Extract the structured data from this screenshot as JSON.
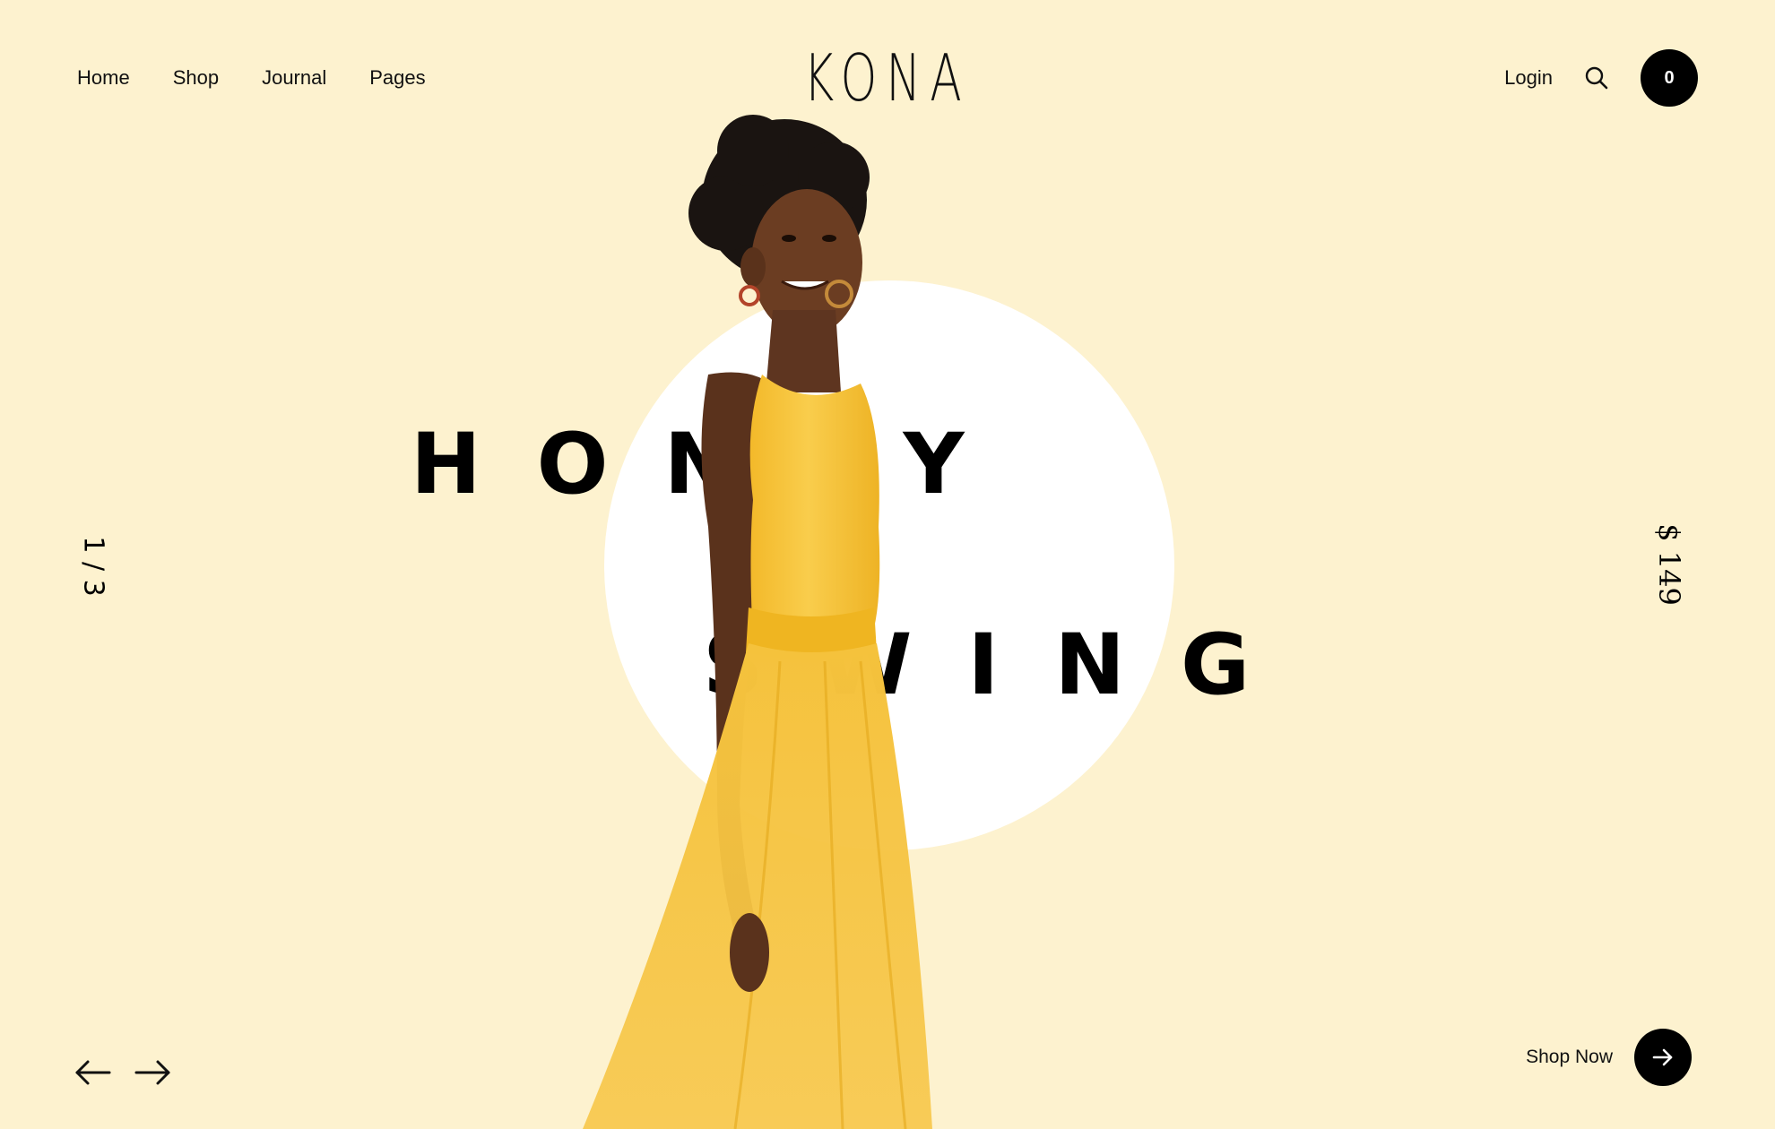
{
  "brand": {
    "logo": "KONA"
  },
  "nav": {
    "items": [
      {
        "label": "Home"
      },
      {
        "label": "Shop"
      },
      {
        "label": "Journal"
      },
      {
        "label": "Pages"
      }
    ]
  },
  "header": {
    "login_label": "Login",
    "search_icon": "search-icon",
    "cart_count": "0"
  },
  "hero": {
    "word_1": "HONEY",
    "word_2": "SWING",
    "slide_counter": "1 / 3",
    "price": "$ 149",
    "image": "model in yellow dress"
  },
  "controls": {
    "prev_icon": "arrow-left-icon",
    "next_icon": "arrow-right-icon",
    "shop_now_label": "Shop Now",
    "shop_now_icon": "arrow-right-icon"
  },
  "colors": {
    "background": "#fdf2cf",
    "circle": "#ffffff",
    "dress": "#f6c33b",
    "text": "#000000"
  }
}
